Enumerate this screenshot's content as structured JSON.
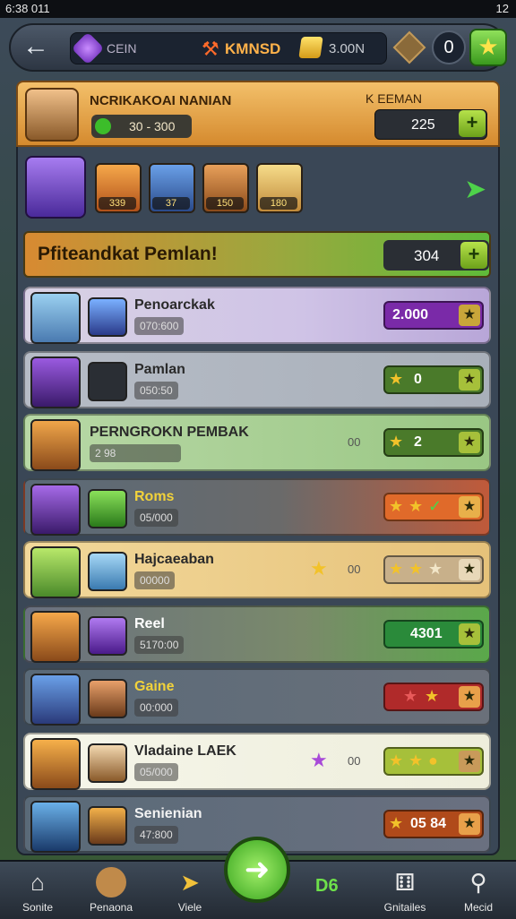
{
  "status": {
    "time": "6:38 011",
    "right": "12"
  },
  "topbar": {
    "gem_label": "CEIN",
    "resource_name": "KMNSD",
    "gold_value": "3.00N",
    "coin_count": "0"
  },
  "header": {
    "title": "NCRIKAKOAI NANIAN",
    "gem_value": "30 - 300",
    "right_label": "K EEMAN",
    "right_value": "225"
  },
  "avatars": [
    {
      "cost": "339"
    },
    {
      "cost": "37"
    },
    {
      "cost": "150"
    },
    {
      "cost": "180"
    }
  ],
  "banner": {
    "title": "Pfiteandkat Pemlan!",
    "value": "304"
  },
  "rows": [
    {
      "name": "Penoarckak",
      "sub": "070:600",
      "reward": "2.000"
    },
    {
      "name": "Pamlan",
      "sub": "050:50",
      "reward": "0"
    },
    {
      "name": "PERNGROKN PEMBAK",
      "sub": "2 98",
      "mid": "00",
      "reward": "2"
    },
    {
      "name": "Roms",
      "sub": "05/000",
      "reward": ""
    },
    {
      "name": "Hajcaeaban",
      "sub": "00000",
      "mid": "00",
      "reward": ""
    },
    {
      "name": "Reel",
      "sub": "5170:00",
      "reward": "4301"
    },
    {
      "name": "Gaine",
      "sub": "00:000",
      "reward": ""
    },
    {
      "name": "Vladaine LAEK",
      "sub": "05/000",
      "mid": "00",
      "reward": ""
    },
    {
      "name": "Senienian",
      "sub": "47:800",
      "reward": "05 84"
    }
  ],
  "nav": {
    "items": [
      "Sonite",
      "Penaona",
      "Viele",
      "Gnitailes",
      "Mecid"
    ],
    "count": "D6"
  },
  "colors": {
    "header_orange": "#d58a2e",
    "green_button": "#6ca11a",
    "panel": "#3a4756"
  }
}
